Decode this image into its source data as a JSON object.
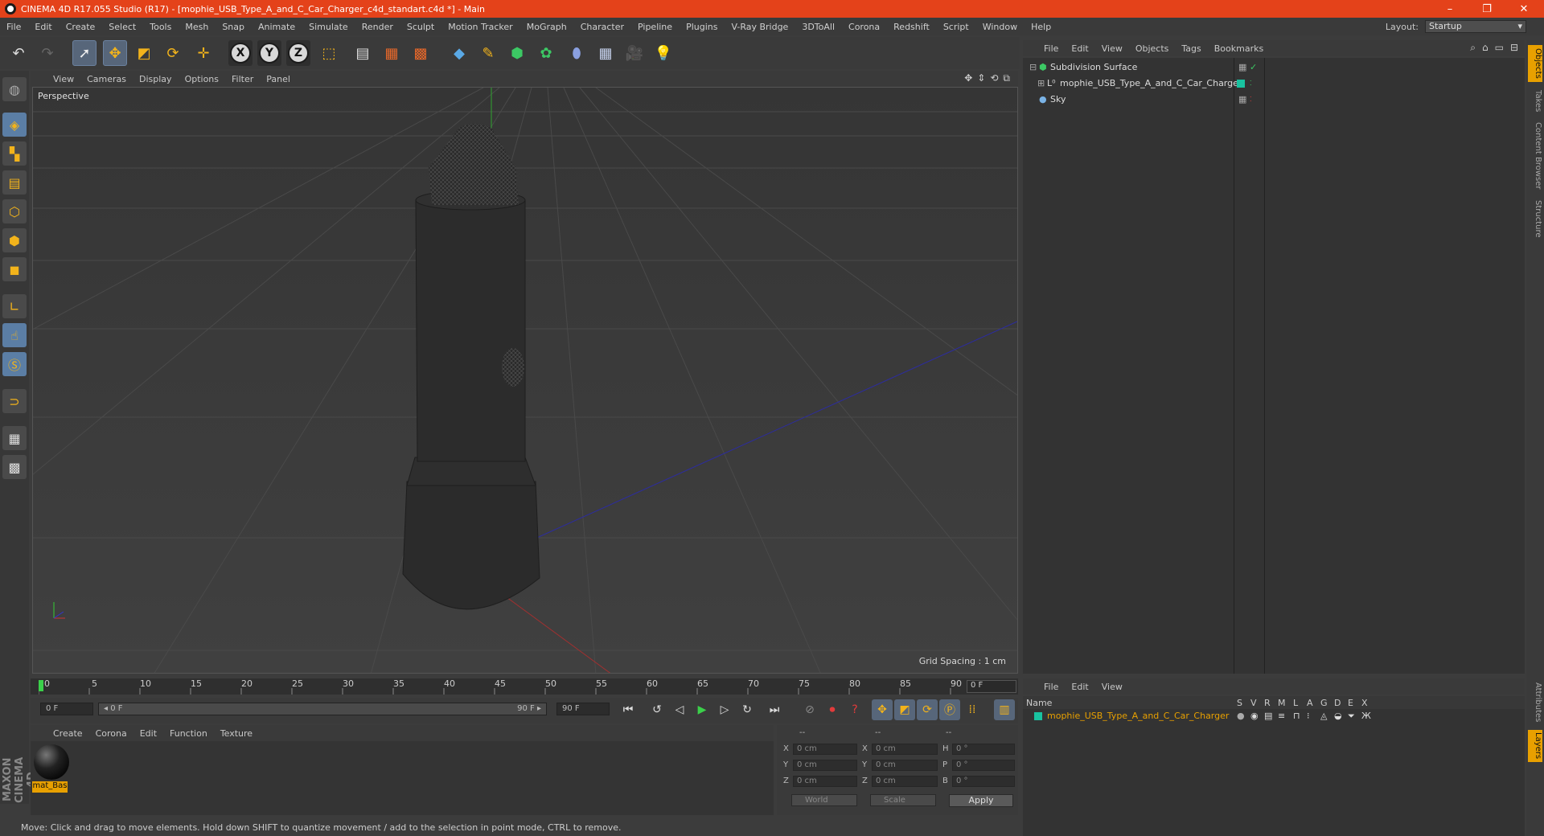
{
  "window": {
    "title": "CINEMA 4D R17.055 Studio (R17) - [mophie_USB_Type_A_and_C_Car_Charger_c4d_standart.c4d *] - Main",
    "controls": [
      "–",
      "❐",
      "✕"
    ]
  },
  "menu": [
    "File",
    "Edit",
    "Create",
    "Select",
    "Tools",
    "Mesh",
    "Snap",
    "Animate",
    "Simulate",
    "Render",
    "Sculpt",
    "Motion Tracker",
    "MoGraph",
    "Character",
    "Pipeline",
    "Plugins",
    "V-Ray Bridge",
    "3DToAll",
    "Corona",
    "Redshift",
    "Script",
    "Window",
    "Help"
  ],
  "layout": {
    "label": "Layout:",
    "value": "Startup"
  },
  "viewport": {
    "menu": [
      "View",
      "Cameras",
      "Display",
      "Options",
      "Filter",
      "Panel"
    ],
    "camera_label": "Perspective",
    "grid_spacing": "Grid Spacing : 1 cm"
  },
  "timeline": {
    "ticks": [
      "0",
      "5",
      "10",
      "15",
      "20",
      "25",
      "30",
      "35",
      "40",
      "45",
      "50",
      "55",
      "60",
      "65",
      "70",
      "75",
      "80",
      "85",
      "90"
    ],
    "current_frame": "0 F",
    "start_field": "0 F",
    "range_start": "◂ 0 F",
    "range_end": "90 F ▸",
    "end_field": "90 F"
  },
  "material_panel": {
    "menu": [
      "Create",
      "Corona",
      "Edit",
      "Function",
      "Texture"
    ],
    "materials": [
      {
        "name": "mat_Bas"
      }
    ]
  },
  "coordinates": {
    "headers": [
      "--",
      "--",
      "--"
    ],
    "rows": [
      {
        "a": "X",
        "av": "0 cm",
        "b": "X",
        "bv": "0 cm",
        "c": "H",
        "cv": "0 °"
      },
      {
        "a": "Y",
        "av": "0 cm",
        "b": "Y",
        "bv": "0 cm",
        "c": "P",
        "cv": "0 °"
      },
      {
        "a": "Z",
        "av": "0 cm",
        "b": "Z",
        "bv": "0 cm",
        "c": "B",
        "cv": "0 °"
      }
    ],
    "space": "World",
    "mode": "Scale",
    "apply": "Apply"
  },
  "status": "Move: Click and drag to move elements. Hold down SHIFT to quantize movement / add to the selection in point mode, CTRL to remove.",
  "object_manager": {
    "menu": [
      "File",
      "Edit",
      "View",
      "Objects",
      "Tags",
      "Bookmarks"
    ],
    "objects": [
      {
        "name": "Subdivision Surface"
      },
      {
        "name": "mophie_USB_Type_A_and_C_Car_Charger"
      },
      {
        "name": "Sky"
      }
    ]
  },
  "side_tabs": [
    "Objects",
    "Takes",
    "Content Browser",
    "Structure"
  ],
  "side_tabs_bottom": [
    "Attributes",
    "Layers"
  ],
  "layer_manager": {
    "menu": [
      "File",
      "Edit",
      "View"
    ],
    "columns": [
      "Name",
      "S",
      "V",
      "R",
      "M",
      "L",
      "A",
      "G",
      "D",
      "E",
      "X"
    ],
    "layers": [
      {
        "name": "mophie_USB_Type_A_and_C_Car_Charger",
        "color": "#19c2a0"
      }
    ]
  },
  "colors": {
    "titlebar": "#e4421a",
    "accent": "#e8a000",
    "highlight": "#5b7ea5"
  }
}
